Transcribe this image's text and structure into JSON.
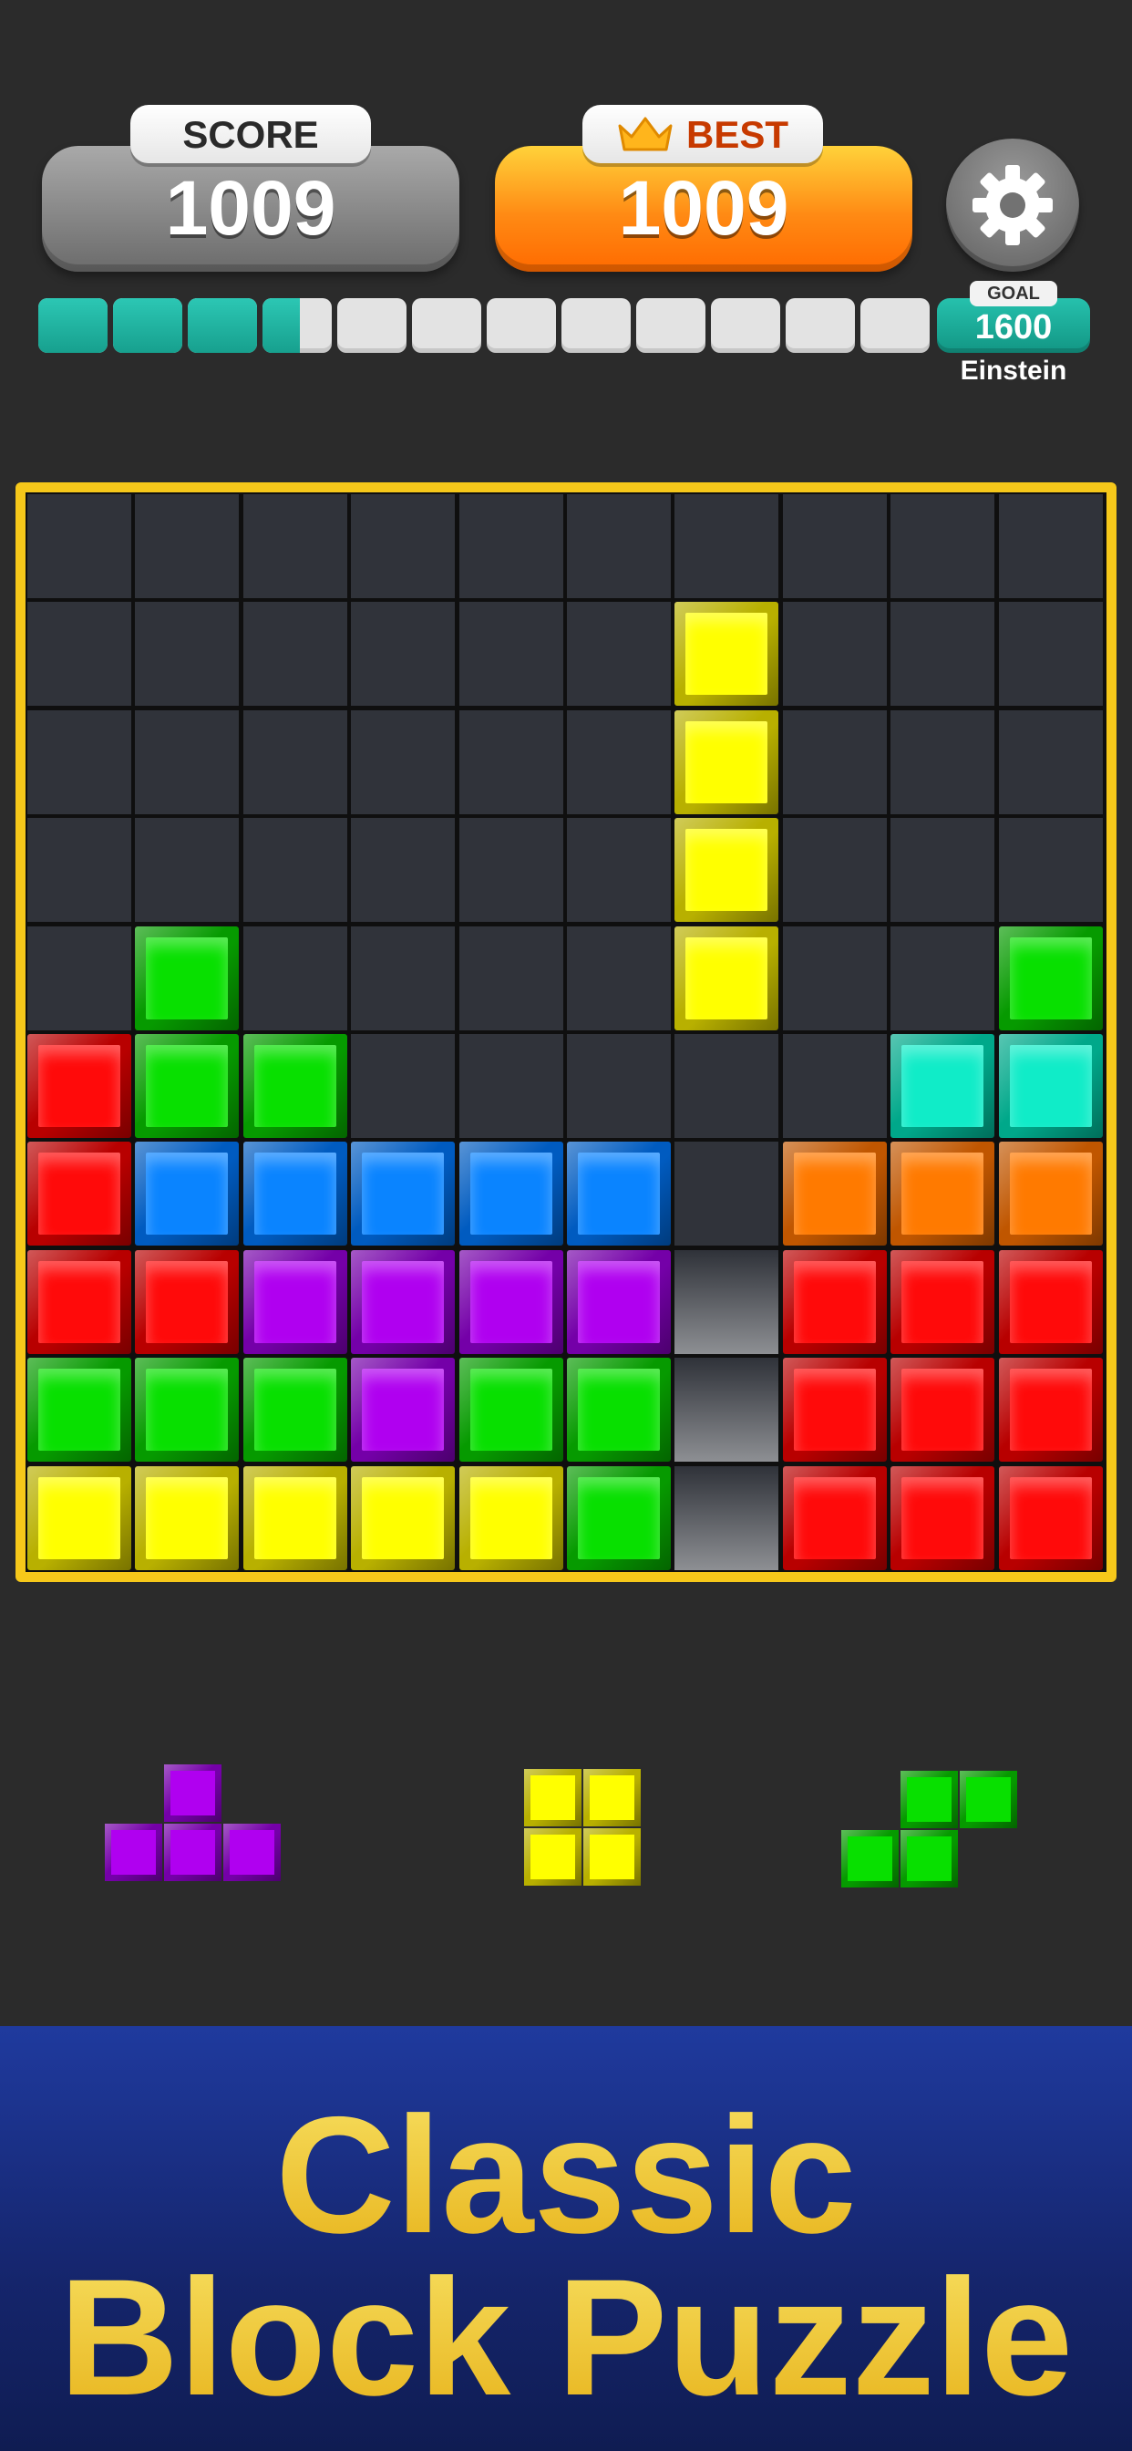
{
  "score": {
    "label": "SCORE",
    "value": "1009"
  },
  "best": {
    "label": "BEST",
    "value": "1009",
    "icon": "crown-icon"
  },
  "settings": {
    "icon": "gear-icon"
  },
  "progress": {
    "segments": 12,
    "filled_fraction": 0.295,
    "fill_color": "#1fb3a1"
  },
  "goal": {
    "label": "GOAL",
    "value": "1600",
    "rank": "Einstein"
  },
  "colors": {
    "red": [
      "#ff0a0a",
      "#b80000"
    ],
    "green": [
      "#08e000",
      "#069a00"
    ],
    "blue": [
      "#0a84ff",
      "#005bc0"
    ],
    "purple": [
      "#b000f0",
      "#7400a8"
    ],
    "yellow": [
      "#ffff00",
      "#b8b000"
    ],
    "orange": [
      "#ff7a00",
      "#c05600"
    ],
    "cyan": [
      "#10ecc8",
      "#00a88a"
    ],
    "board_frame": "#f6c81a"
  },
  "board": {
    "rows": 10,
    "cols": 10,
    "grid": [
      [
        ".",
        ".",
        ".",
        ".",
        ".",
        ".",
        ".",
        ".",
        ".",
        "."
      ],
      [
        ".",
        ".",
        ".",
        ".",
        ".",
        ".",
        "Y",
        ".",
        ".",
        "."
      ],
      [
        ".",
        ".",
        ".",
        ".",
        ".",
        ".",
        "Y",
        ".",
        ".",
        "."
      ],
      [
        ".",
        ".",
        ".",
        ".",
        ".",
        ".",
        "Y",
        ".",
        ".",
        "."
      ],
      [
        ".",
        "G",
        ".",
        ".",
        ".",
        ".",
        "Y",
        ".",
        ".",
        "G"
      ],
      [
        "R",
        "G",
        "G",
        ".",
        ".",
        ".",
        ".",
        ".",
        "C",
        "C"
      ],
      [
        "R",
        "B",
        "B",
        "B",
        "B",
        "B",
        ".",
        "O",
        "O",
        "O"
      ],
      [
        "R",
        "R",
        "P",
        "P",
        "P",
        "P",
        "x",
        "R",
        "R",
        "R"
      ],
      [
        "G",
        "G",
        "G",
        "P",
        "G",
        "G",
        "x",
        "R",
        "R",
        "R"
      ],
      [
        "Y",
        "Y",
        "Y",
        "Y",
        "Y",
        "G",
        "x",
        "R",
        "R",
        "R"
      ]
    ]
  },
  "pieces": [
    {
      "name": "purple-t-piece",
      "color": "purple",
      "cells": [
        [
          1,
          0
        ],
        [
          0,
          1
        ],
        [
          1,
          1
        ],
        [
          2,
          1
        ]
      ]
    },
    {
      "name": "yellow-square-piece",
      "color": "yellow",
      "cells": [
        [
          0,
          0
        ],
        [
          1,
          0
        ],
        [
          0,
          1
        ],
        [
          1,
          1
        ]
      ]
    },
    {
      "name": "green-s-piece",
      "color": "green",
      "cells": [
        [
          1,
          0
        ],
        [
          2,
          0
        ],
        [
          0,
          1
        ],
        [
          1,
          1
        ]
      ]
    }
  ],
  "banner": {
    "line1": "Classic",
    "line2": "Block Puzzle"
  }
}
